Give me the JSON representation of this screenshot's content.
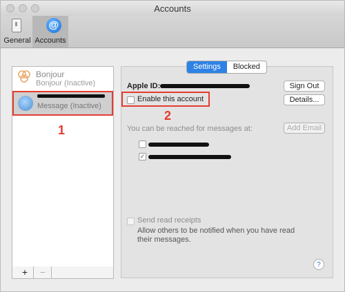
{
  "window": {
    "title": "Accounts"
  },
  "toolbar": {
    "tabs": [
      {
        "label": "General",
        "icon": "general-switch-icon"
      },
      {
        "label": "Accounts",
        "icon": "at-sign-icon",
        "icon_glyph": "@"
      }
    ]
  },
  "accounts_list": {
    "items": [
      {
        "name": "Bonjour",
        "status": "Bonjour (Inactive)"
      },
      {
        "status": "Message (Inactive)"
      }
    ],
    "footer": {
      "add": "+",
      "remove": "−"
    }
  },
  "annotations": {
    "box1": "1",
    "box2": "2",
    "color": "#e53b2e"
  },
  "settings": {
    "tabs": [
      "Settings",
      "Blocked"
    ],
    "apple_id_label": "Apple ID:",
    "sign_out": "Sign Out",
    "enable_label": "Enable this account",
    "details": "Details...",
    "reached_label": "You can be reached for messages at:",
    "add_email": "Add Email",
    "send_read_receipts": "Send read receipts",
    "receipts_desc_1": "Allow others to be notified when you have read",
    "receipts_desc_2": "their messages.",
    "help": "?"
  }
}
